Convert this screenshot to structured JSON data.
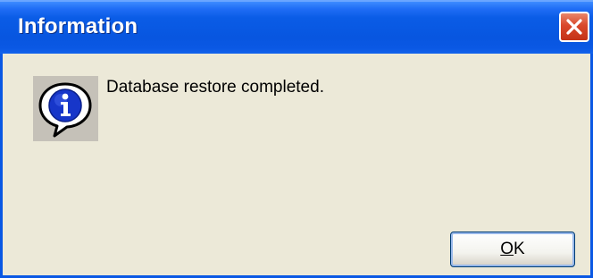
{
  "window": {
    "title": "Information"
  },
  "titlebar": {
    "close_icon": "close-icon"
  },
  "dialog": {
    "icon": "information-icon",
    "message": "Database restore completed."
  },
  "buttons": {
    "ok_label_mnemonic": "O",
    "ok_label_rest": "K"
  },
  "colors": {
    "titlebar": "#0a58e4",
    "client_background": "#ece9d8",
    "close_button": "#d9482b"
  }
}
